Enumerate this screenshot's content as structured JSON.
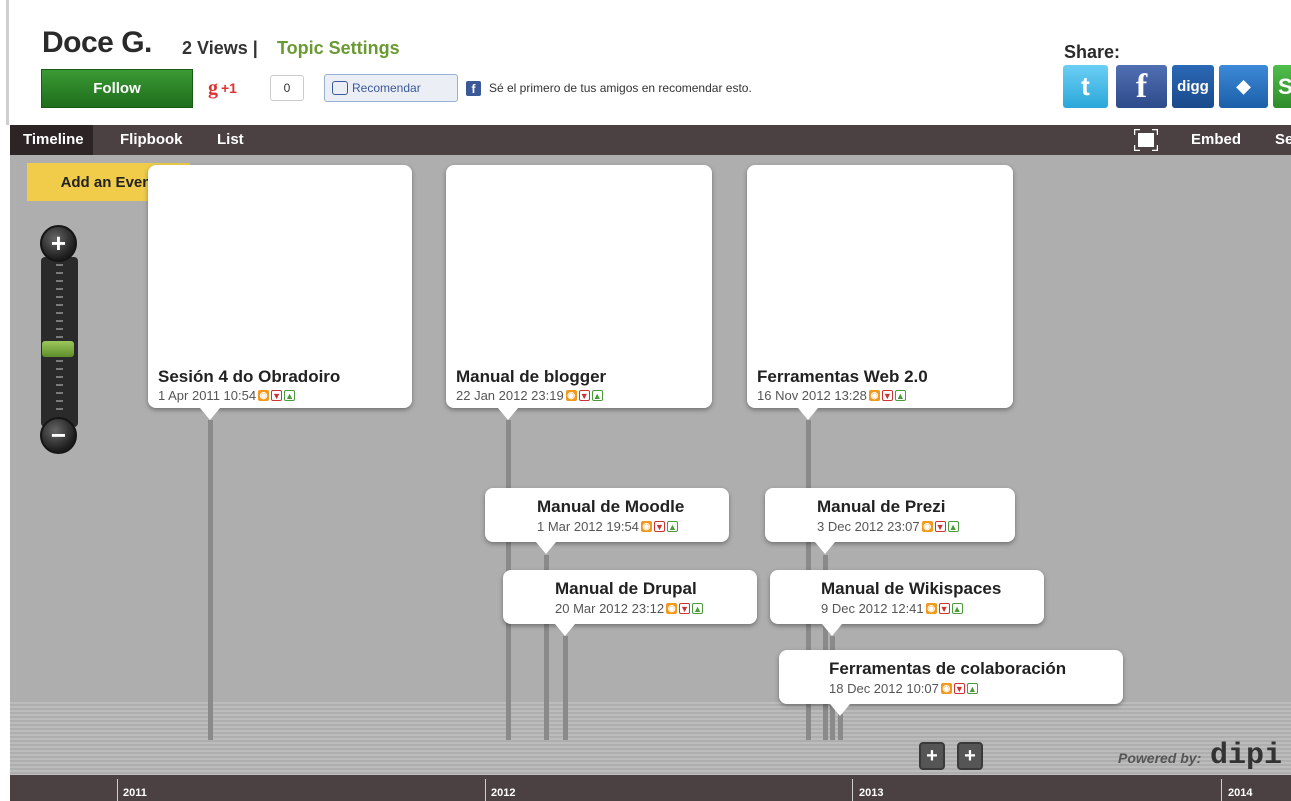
{
  "header": {
    "title": "Doce G.",
    "views": "2 Views |",
    "topic_settings": "Topic Settings",
    "follow": "Follow",
    "gplus_label": "+1",
    "gplus_count": "0",
    "recommend": "Recomendar",
    "fb_text": "Sé el primero de tus amigos en recomendar esto.",
    "share_label": "Share:",
    "share_buttons": [
      "twitter-icon",
      "facebook-icon",
      "digg-icon",
      "myspace-icon",
      "stumbleupon-icon"
    ]
  },
  "nav": {
    "tabs": [
      "Timeline",
      "Flipbook",
      "List"
    ],
    "embed": "Embed",
    "settings": "Se"
  },
  "timeline": {
    "add_event": "Add an Event",
    "events": [
      {
        "title": "Sesión 4 do Obradoiro",
        "date": "1 Apr 2011 10:54"
      },
      {
        "title": "Manual de blogger",
        "date": "22 Jan 2012 23:19"
      },
      {
        "title": "Ferramentas Web 2.0",
        "date": "16 Nov 2012 13:28"
      },
      {
        "title": "Manual de Moodle",
        "date": "1 Mar 2012 19:54"
      },
      {
        "title": "Manual de Prezi",
        "date": "3 Dec 2012 23:07"
      },
      {
        "title": "Manual de Drupal",
        "date": "20 Mar 2012 23:12"
      },
      {
        "title": "Manual de Wikispaces",
        "date": "9 Dec 2012 12:41"
      },
      {
        "title": "Ferramentas de colaboración",
        "date": "18 Dec 2012 10:07"
      }
    ],
    "powered_by": "Powered by:",
    "powered_logo": "dipi",
    "years": [
      "2011",
      "2012",
      "2013",
      "2014"
    ]
  },
  "colors": {
    "follow": "#2a8a28",
    "add_event": "#f0cc4a",
    "navbar": "#4c4142",
    "canvas": "#aeaeae",
    "topic_settings": "#6a9a32"
  }
}
